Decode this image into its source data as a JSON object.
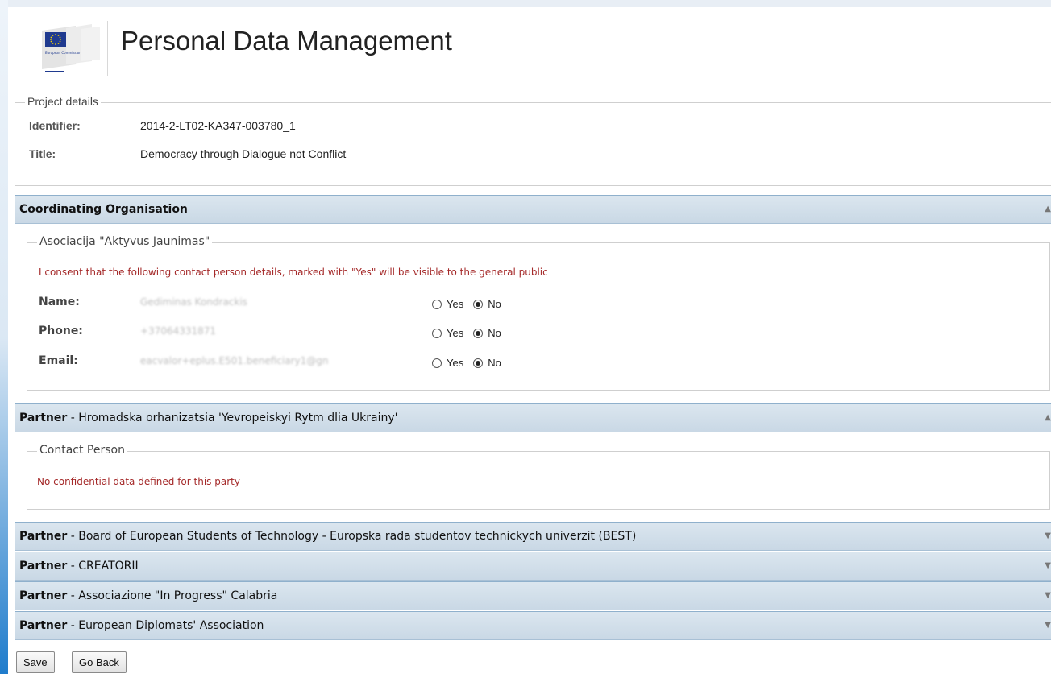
{
  "header": {
    "title": "Personal Data Management",
    "logo_text": "European Commission"
  },
  "project_details": {
    "legend": "Project details",
    "identifier_label": "Identifier:",
    "identifier_value": "2014-2-LT02-KA347-003780_1",
    "title_label": "Title:",
    "title_value": "Democracy through Dialogue not Conflict"
  },
  "coordinating": {
    "header": "Coordinating Organisation",
    "org_name": "Asociacija \"Aktyvus Jaunimas\"",
    "consent_text": "I consent that the following contact person details, marked with \"Yes\" will be visible to the general public",
    "fields": [
      {
        "label": "Name:",
        "value": "Gediminas Kondrackis",
        "yes": "Yes",
        "no": "No",
        "selected": "No"
      },
      {
        "label": "Phone:",
        "value": "+37064331871",
        "yes": "Yes",
        "no": "No",
        "selected": "No"
      },
      {
        "label": "Email:",
        "value": "eacvalor+eplus.E501.beneficiary1@gn",
        "yes": "Yes",
        "no": "No",
        "selected": "No"
      }
    ]
  },
  "partners": [
    {
      "prefix": "Partner",
      "name": " - Hromadska orhanizatsia 'Yevropeiskyi Rytm dlia Ukrainy'",
      "expanded": true
    },
    {
      "prefix": "Partner",
      "name": " - Board of European Students of Technology - Europska rada studentov technickych univerzit (BEST)",
      "expanded": false
    },
    {
      "prefix": "Partner",
      "name": " - CREATORII",
      "expanded": false
    },
    {
      "prefix": "Partner",
      "name": " - Associazione \"In Progress\" Calabria",
      "expanded": false
    },
    {
      "prefix": "Partner",
      "name": " - European Diplomats' Association",
      "expanded": false
    }
  ],
  "partner_contact": {
    "legend": "Contact Person",
    "message": "No confidential data defined for this party"
  },
  "buttons": {
    "save": "Save",
    "go_back": "Go Back"
  },
  "colors": {
    "panel_header": "#c9d8e5",
    "alert_text": "#a52a2a",
    "eu_blue": "#1f3a8f",
    "eu_yellow": "#f5d400"
  }
}
